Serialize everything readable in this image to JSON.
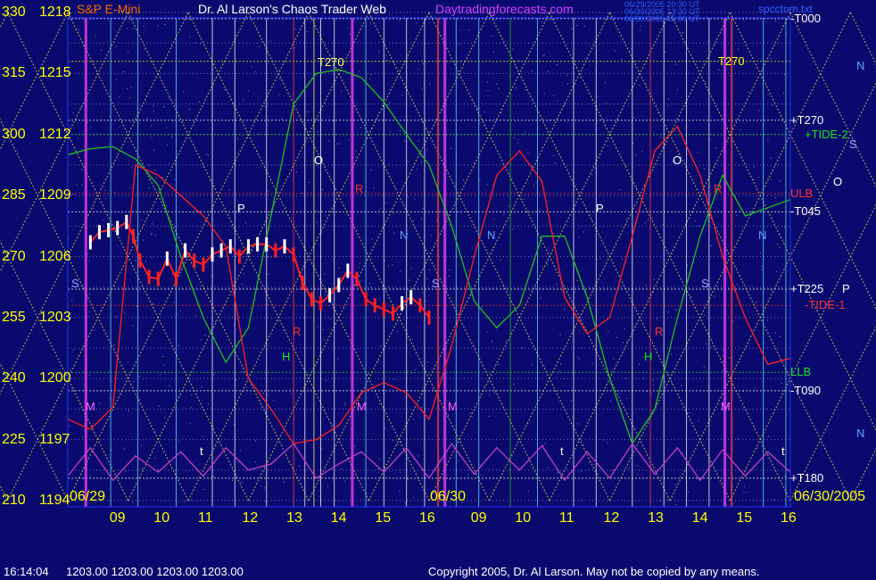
{
  "header": {
    "instrument": "S&P E-Mini",
    "title": "Dr. Al Larson's Chaos Trader Web",
    "site": "Daytradingforecasts.com",
    "stamp_lines": [
      "06/29/2005 20:30 UT",
      "06/30/2005 13:30 UT",
      "06/30/2005 15:30 UT"
    ],
    "file": "spcctom.txt"
  },
  "footer": {
    "time": "16:14:04",
    "ohlc": "1203.00 1203.00 1203.00 1203.00",
    "copyright": "Copyright 2005, Dr. Al Larson. May not be copied by any means."
  },
  "colors": {
    "background": "#0a0a6e",
    "price": "#ff2020",
    "bars_up": "#ffffff",
    "flux": "#20c020",
    "tide": "#ff2020",
    "oscillator": "#c040c0",
    "grid_horizontal": "#ffffff",
    "diagonals": "#e0e060",
    "axis_text": "#ffff00"
  },
  "chart_data": {
    "type": "line",
    "title": "S&P E-Mini",
    "y_axis": {
      "left_scale": [
        330,
        315,
        300,
        285,
        270,
        255,
        240,
        225,
        210
      ],
      "price_scale": [
        1218,
        1215,
        1212,
        1209,
        1206,
        1203,
        1200,
        1197,
        1194
      ],
      "ylim": [
        1194,
        1218
      ]
    },
    "x_axis": {
      "day1_ticks": [
        "09",
        "10",
        "11",
        "12",
        "13",
        "14",
        "15",
        "16"
      ],
      "day2_ticks": [
        "09",
        "10",
        "11",
        "12",
        "13",
        "14",
        "15",
        "16"
      ],
      "date_labels": [
        "06/29",
        "06/30",
        "06/30/2005"
      ]
    },
    "right_labels": [
      {
        "text": "-T000",
        "price": 1217.7,
        "color": "#ffffff"
      },
      {
        "text": "T270",
        "price": 1215.6,
        "color": "#ffff00"
      },
      {
        "text": "+T270",
        "price": 1212.7,
        "color": "#ffffff"
      },
      {
        "text": "+TIDE-2",
        "price": 1212.0,
        "color": "#20e020"
      },
      {
        "text": "ULB",
        "price": 1209.1,
        "color": "#ff3030"
      },
      {
        "text": "-T045",
        "price": 1208.2,
        "color": "#ffffff"
      },
      {
        "text": "+T225",
        "price": 1204.4,
        "color": "#ffffff"
      },
      {
        "text": "-TIDE-1",
        "price": 1203.6,
        "color": "#ff3030"
      },
      {
        "text": "LLB",
        "price": 1200.3,
        "color": "#20e020"
      },
      {
        "text": "-T090",
        "price": 1199.4,
        "color": "#ffffff"
      },
      {
        "text": "+T180",
        "price": 1195.1,
        "color": "#ffffff"
      }
    ],
    "other_labels": [
      "T270",
      "O",
      "P",
      "N",
      "S",
      "R",
      "H",
      "M",
      "t"
    ],
    "price_series": {
      "name": "S&P E-Mini",
      "x_hours": [
        8.5,
        8.7,
        8.9,
        9.1,
        9.3,
        9.45,
        9.6,
        9.8,
        10.0,
        10.2,
        10.4,
        10.6,
        10.8,
        11.0,
        11.2,
        11.4,
        11.6,
        11.8,
        12.0,
        12.2,
        12.4,
        12.6,
        12.8,
        13.0,
        13.2,
        13.4,
        13.6,
        13.8,
        14.0,
        14.2,
        14.4,
        14.6,
        14.8,
        15.0,
        15.2,
        15.4,
        15.6,
        15.8,
        16.0
      ],
      "values": [
        1206.7,
        1207.2,
        1207.3,
        1207.4,
        1207.7,
        1207.0,
        1205.8,
        1205.0,
        1204.9,
        1205.9,
        1204.9,
        1206.3,
        1205.8,
        1205.6,
        1206.1,
        1206.3,
        1206.5,
        1206.0,
        1206.5,
        1206.6,
        1206.6,
        1206.3,
        1206.5,
        1206.1,
        1204.7,
        1203.9,
        1203.7,
        1204.1,
        1204.6,
        1205.3,
        1204.9,
        1203.9,
        1203.6,
        1203.4,
        1203.2,
        1203.7,
        1204.0,
        1203.6,
        1203.0
      ]
    },
    "flux_series": {
      "x_hours": [
        8.0,
        8.5,
        9.0,
        9.5,
        10.0,
        10.5,
        11.0,
        11.5,
        12.0,
        12.5,
        13.0,
        13.5,
        14.0,
        14.5,
        15.0,
        15.5,
        16.0,
        16.5,
        17.0,
        17.5,
        18.0,
        18.5,
        19.0,
        19.5,
        20.0,
        20.5,
        21.0,
        21.5,
        22.0,
        22.5,
        23.0,
        23.5,
        24.0
      ],
      "values": [
        1211.0,
        1211.3,
        1211.4,
        1210.8,
        1209.5,
        1206.0,
        1203.0,
        1200.8,
        1202.5,
        1208.0,
        1213.5,
        1215.0,
        1215.2,
        1214.8,
        1213.6,
        1212.0,
        1210.5,
        1207.5,
        1203.8,
        1202.5,
        1203.6,
        1207.0,
        1207.0,
        1204.0,
        1200.0,
        1196.8,
        1198.5,
        1203.0,
        1207.0,
        1210.0,
        1208.0,
        1208.4,
        1208.8
      ]
    },
    "tide_series": {
      "x_hours": [
        8.0,
        8.5,
        9.0,
        9.5,
        10.0,
        10.5,
        11.0,
        11.5,
        12.0,
        12.5,
        13.0,
        13.5,
        14.0,
        14.5,
        15.0,
        15.5,
        16.0,
        16.5,
        17.0,
        17.5,
        18.0,
        18.5,
        19.0,
        19.5,
        20.0,
        20.5,
        21.0,
        21.5,
        22.0,
        22.5,
        23.0,
        23.5,
        24.0
      ],
      "values": [
        1198.0,
        1197.5,
        1198.6,
        1210.5,
        1210.0,
        1209.0,
        1208.0,
        1206.5,
        1200.0,
        1198.5,
        1196.8,
        1197.0,
        1197.7,
        1199.3,
        1199.8,
        1199.3,
        1198.0,
        1201.6,
        1206.0,
        1210.0,
        1211.2,
        1209.7,
        1204.0,
        1202.2,
        1203.0,
        1207.0,
        1211.2,
        1212.4,
        1210.0,
        1206.0,
        1203.0,
        1200.7,
        1201.0
      ]
    },
    "oscillator_series": {
      "x_hours": [
        8.0,
        8.5,
        9.0,
        9.5,
        10.0,
        10.5,
        11.0,
        11.5,
        12.0,
        12.5,
        13.0,
        13.5,
        14.0,
        14.5,
        15.0,
        15.5,
        16.0,
        16.5,
        17.0,
        17.5,
        18.0,
        18.5,
        19.0,
        19.5,
        20.0,
        20.5,
        21.0,
        21.5,
        22.0,
        22.5,
        23.0,
        23.5,
        24.0
      ],
      "values": [
        1195.2,
        1196.6,
        1195.0,
        1196.2,
        1195.4,
        1196.4,
        1195.2,
        1196.6,
        1195.5,
        1195.8,
        1196.8,
        1195.1,
        1195.8,
        1196.4,
        1195.4,
        1196.6,
        1195.1,
        1196.8,
        1195.3,
        1196.6,
        1195.5,
        1196.7,
        1195.0,
        1196.4,
        1195.1,
        1196.8,
        1195.3,
        1196.6,
        1195.0,
        1196.5,
        1195.2,
        1196.4,
        1195.4
      ]
    }
  }
}
